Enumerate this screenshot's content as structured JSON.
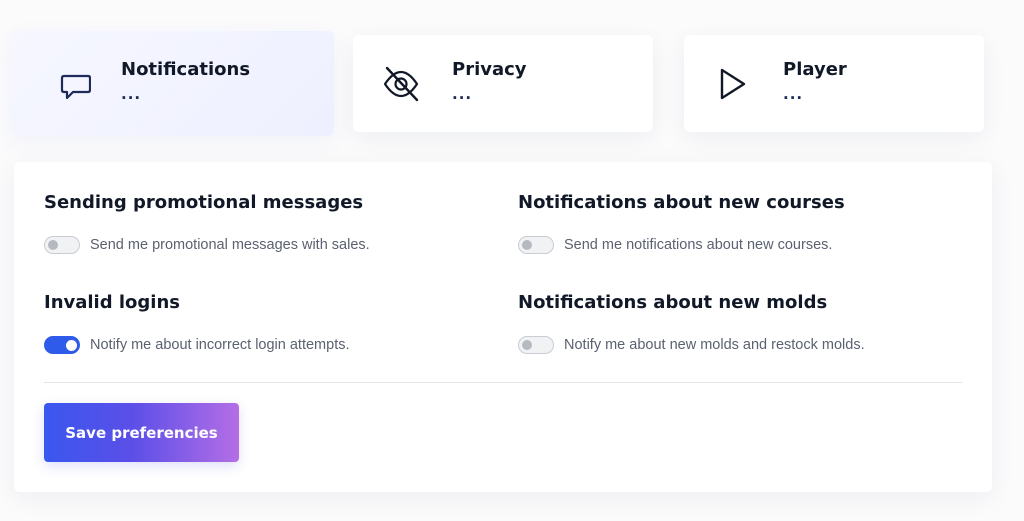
{
  "tabs": [
    {
      "title": "Notifications",
      "subtitle": "...",
      "icon": "message-square-icon",
      "active": true
    },
    {
      "title": "Privacy",
      "subtitle": "...",
      "icon": "eye-off-icon",
      "active": false
    },
    {
      "title": "Player",
      "subtitle": "...",
      "icon": "play-icon",
      "active": false
    }
  ],
  "settings": {
    "promotional": {
      "title": "Sending promotional messages",
      "label": "Send me promotional messages with sales.",
      "enabled": false
    },
    "new_courses": {
      "title": "Notifications about new courses",
      "label": "Send me notifications about new courses.",
      "enabled": false
    },
    "invalid_logins": {
      "title": "Invalid logins",
      "label": "Notify me about incorrect login attempts.",
      "enabled": true
    },
    "new_molds": {
      "title": "Notifications about new molds",
      "label": "Notify me about new molds and restock molds.",
      "enabled": false
    }
  },
  "save_button": {
    "label": "Save preferencies"
  },
  "colors": {
    "accent": "#2f5bea",
    "button_gradient_start": "#3957ee",
    "button_gradient_end": "#b46ee6",
    "icon_navy": "#1e2a5a"
  }
}
